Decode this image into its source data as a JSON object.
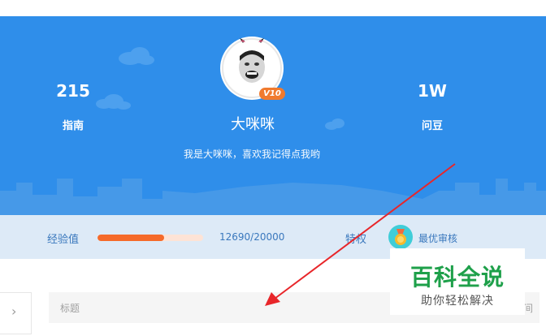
{
  "profile": {
    "left_stat": {
      "value": "215",
      "label": "指南"
    },
    "right_stat": {
      "value": "1W",
      "label": "问豆"
    },
    "level_badge": "V10",
    "username": "大咪咪",
    "bio": "我是大咪咪，喜欢我记得点我哟"
  },
  "experience": {
    "label": "经验值",
    "value_text": "12690/20000",
    "progress_fraction": 0.6345
  },
  "privilege": {
    "label": "特权",
    "item": "最优审核",
    "icon": "medal-icon"
  },
  "form": {
    "title_placeholder": "标题",
    "right_fragment": "间"
  },
  "watermark": {
    "title": "百科全说",
    "subtitle": "助你轻松解决"
  },
  "colors": {
    "hero_blue": "#2f8eea",
    "progress_orange": "#f56a2a",
    "annotation_red": "#e8262a",
    "watermark_green": "#1ea04a"
  }
}
